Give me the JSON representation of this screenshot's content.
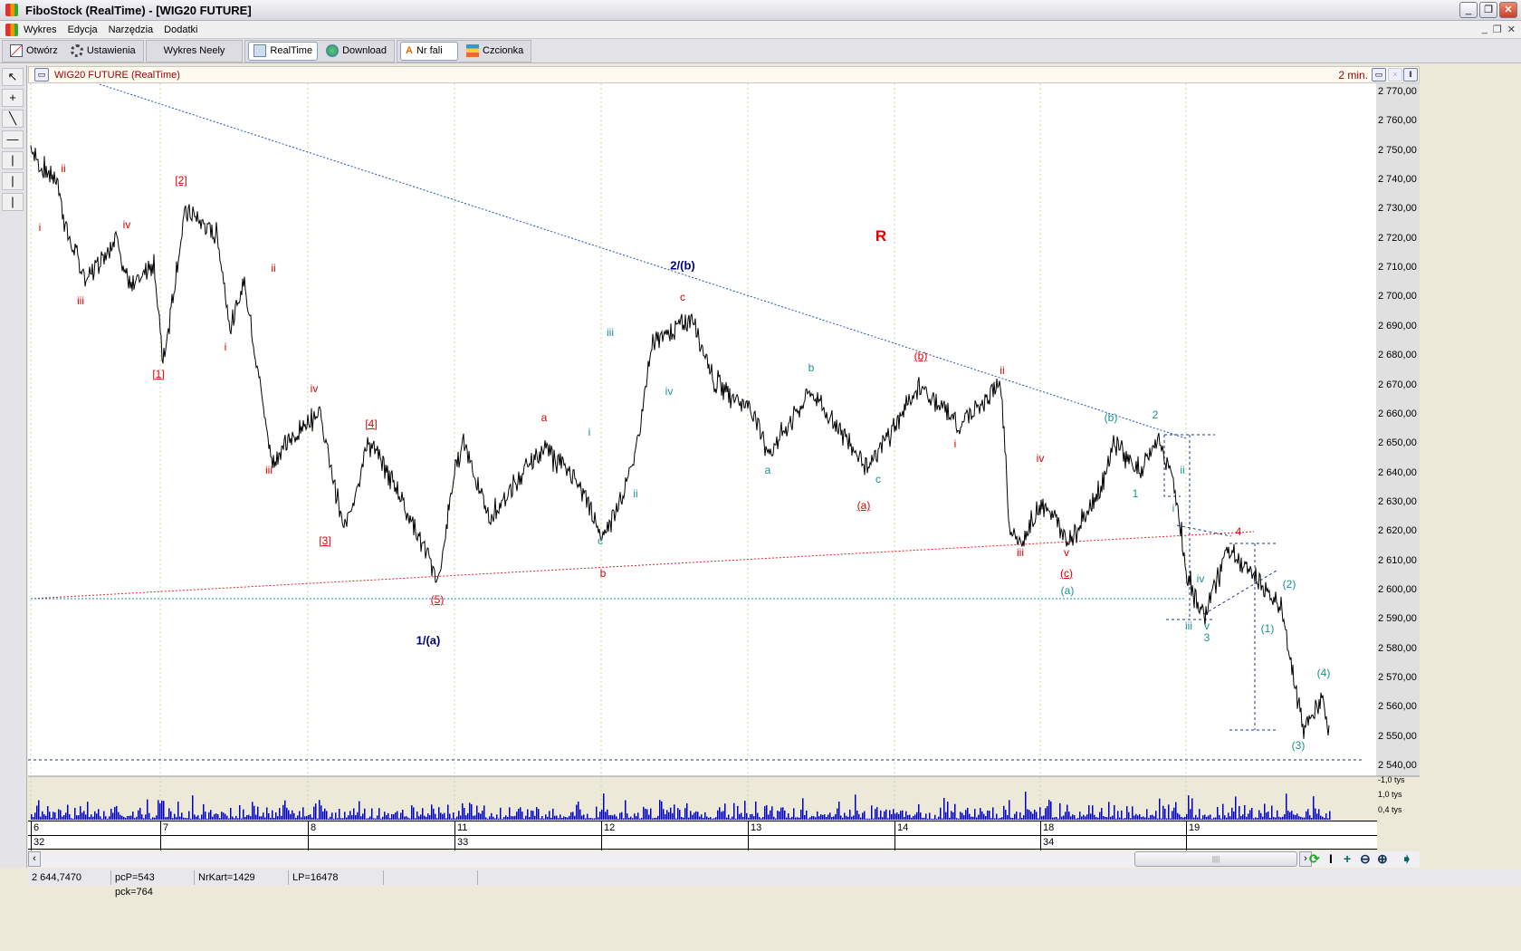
{
  "window": {
    "title": "FiboStock (RealTime) - [WIG20 FUTURE]",
    "controls": [
      "_",
      "❐",
      "✕"
    ]
  },
  "menu": {
    "items": [
      "Wykres",
      "Edycja",
      "Narzędzia",
      "Dodatki"
    ],
    "mdi_controls": [
      "_",
      "❐",
      "✕"
    ]
  },
  "toolbar": {
    "otworz": "Otwórz",
    "ustawienia": "Ustawienia",
    "wykres_neely": "Wykres Neely",
    "realtime": "RealTime",
    "download": "Download",
    "nr_fali": "Nr fali",
    "czcionka": "Czcionka"
  },
  "left_tools": [
    "pointer",
    "crosshair",
    "trend-line",
    "horizontal-line",
    "vertical-line",
    "vertical-line-2",
    "vertical-line-3"
  ],
  "chart_header": {
    "instrument": "WIG20 FUTURE (RealTime)",
    "interval": "2 min."
  },
  "colors": {
    "red": "#e00000",
    "teal": "#1a9090",
    "navy": "#000080",
    "volume": "#0000c0"
  },
  "chart_data": {
    "type": "line",
    "title": "WIG20 FUTURE (RealTime)",
    "ylim": [
      2540,
      2770
    ],
    "y_ticks": [
      "2 770,00",
      "2 760,00",
      "2 750,00",
      "2 740,00",
      "2 730,00",
      "2 720,00",
      "2 710,00",
      "2 700,00",
      "2 690,00",
      "2 680,00",
      "2 670,00",
      "2 660,00",
      "2 650,00",
      "2 640,00",
      "2 630,00",
      "2 620,00",
      "2 610,00",
      "2 600,00",
      "2 590,00",
      "2 580,00",
      "2 570,00",
      "2 560,00",
      "2 550,00",
      "2 540,00"
    ],
    "volume_ticks": [
      "1,0 tys",
      "0,4 tys"
    ],
    "days": [
      {
        "label": "6",
        "bar": 0
      },
      {
        "label": "7",
        "bar": 143
      },
      {
        "label": "8",
        "bar": 306
      },
      {
        "label": "11",
        "bar": 468
      },
      {
        "label": "12",
        "bar": 630
      },
      {
        "label": "13",
        "bar": 792
      },
      {
        "label": "14",
        "bar": 954
      },
      {
        "label": "18",
        "bar": 1115
      },
      {
        "label": "19",
        "bar": 1276
      }
    ],
    "weeks": [
      {
        "label": "32",
        "bar": 0
      },
      {
        "label": "",
        "bar": 143
      },
      {
        "label": "",
        "bar": 306
      },
      {
        "label": "33",
        "bar": 468
      },
      {
        "label": "",
        "bar": 630
      },
      {
        "label": "",
        "bar": 792
      },
      {
        "label": "",
        "bar": 954
      },
      {
        "label": "34",
        "bar": 1115
      },
      {
        "label": "",
        "bar": 1276
      }
    ],
    "price_path": [
      [
        0,
        2752
      ],
      [
        11,
        2744
      ],
      [
        28,
        2741
      ],
      [
        41,
        2721
      ],
      [
        61,
        2706
      ],
      [
        94,
        2721
      ],
      [
        111,
        2702
      ],
      [
        136,
        2712
      ],
      [
        146,
        2678
      ],
      [
        171,
        2730
      ],
      [
        206,
        2721
      ],
      [
        221,
        2689
      ],
      [
        236,
        2706
      ],
      [
        266,
        2644
      ],
      [
        318,
        2662
      ],
      [
        346,
        2620
      ],
      [
        373,
        2651
      ],
      [
        406,
        2634
      ],
      [
        451,
        2603
      ],
      [
        466,
        2637
      ],
      [
        478,
        2652
      ],
      [
        506,
        2624
      ],
      [
        566,
        2649
      ],
      [
        606,
        2637
      ],
      [
        631,
        2617
      ],
      [
        666,
        2643
      ],
      [
        686,
        2684
      ],
      [
        731,
        2693
      ],
      [
        756,
        2671
      ],
      [
        796,
        2662
      ],
      [
        816,
        2647
      ],
      [
        861,
        2668
      ],
      [
        926,
        2642
      ],
      [
        981,
        2670
      ],
      [
        1026,
        2656
      ],
      [
        1071,
        2671
      ],
      [
        1081,
        2622
      ],
      [
        1096,
        2616
      ],
      [
        1116,
        2631
      ],
      [
        1146,
        2617
      ],
      [
        1181,
        2634
      ],
      [
        1196,
        2651
      ],
      [
        1226,
        2640
      ],
      [
        1246,
        2652
      ],
      [
        1266,
        2632
      ],
      [
        1276,
        2605
      ],
      [
        1296,
        2591
      ],
      [
        1321,
        2614
      ],
      [
        1356,
        2603
      ],
      [
        1381,
        2594
      ],
      [
        1406,
        2552
      ],
      [
        1426,
        2563
      ],
      [
        1434,
        2554
      ]
    ],
    "wave_labels": [
      {
        "t": "i",
        "c": "red",
        "bar": 10,
        "p": 2724
      },
      {
        "t": "ii",
        "c": "red",
        "bar": 36,
        "p": 2744
      },
      {
        "t": "iii",
        "c": "red",
        "bar": 55,
        "p": 2699
      },
      {
        "t": "iv",
        "c": "red",
        "bar": 106,
        "p": 2725
      },
      {
        "t": "[1]",
        "c": "red",
        "bar": 141,
        "p": 2674
      },
      {
        "t": "[2]",
        "c": "red",
        "bar": 166,
        "p": 2740
      },
      {
        "t": "ii",
        "c": "red",
        "bar": 268,
        "p": 2710
      },
      {
        "t": "i",
        "c": "red",
        "bar": 215,
        "p": 2683
      },
      {
        "t": "iii",
        "c": "red",
        "bar": 263,
        "p": 2641
      },
      {
        "t": "iv",
        "c": "red",
        "bar": 313,
        "p": 2669
      },
      {
        "t": "[4]",
        "c": "red",
        "bar": 376,
        "p": 2657
      },
      {
        "t": "[3]",
        "c": "red",
        "bar": 325,
        "p": 2617
      },
      {
        "t": "(5)",
        "c": "red",
        "bar": 449,
        "p": 2597
      },
      {
        "t": "a",
        "c": "red",
        "bar": 567,
        "p": 2659
      },
      {
        "t": "i",
        "c": "teal",
        "bar": 617,
        "p": 2654
      },
      {
        "t": "iii",
        "c": "teal",
        "bar": 640,
        "p": 2688
      },
      {
        "t": "ii",
        "c": "teal",
        "bar": 668,
        "p": 2633
      },
      {
        "t": "iv",
        "c": "teal",
        "bar": 705,
        "p": 2668
      },
      {
        "t": "c",
        "c": "teal",
        "bar": 629,
        "p": 2617
      },
      {
        "t": "b",
        "c": "red",
        "bar": 632,
        "p": 2606
      },
      {
        "t": "c",
        "c": "red",
        "bar": 720,
        "p": 2700
      },
      {
        "t": "2/(b)",
        "c": "navy",
        "bar": 720,
        "p": 2711
      },
      {
        "t": "1/(a)",
        "c": "navy",
        "bar": 439,
        "p": 2583
      },
      {
        "t": "R",
        "c": "red big",
        "bar": 939,
        "p": 2721
      },
      {
        "t": "b",
        "c": "teal",
        "bar": 862,
        "p": 2676
      },
      {
        "t": "a",
        "c": "teal",
        "bar": 814,
        "p": 2641
      },
      {
        "t": "c",
        "c": "teal",
        "bar": 936,
        "p": 2638
      },
      {
        "t": "(a)",
        "c": "red",
        "bar": 920,
        "p": 2629
      },
      {
        "t": "(b)",
        "c": "red",
        "bar": 983,
        "p": 2680
      },
      {
        "t": "i",
        "c": "red",
        "bar": 1021,
        "p": 2650
      },
      {
        "t": "ii",
        "c": "red",
        "bar": 1073,
        "p": 2675
      },
      {
        "t": "iv",
        "c": "red",
        "bar": 1115,
        "p": 2645
      },
      {
        "t": "iii",
        "c": "red",
        "bar": 1093,
        "p": 2613
      },
      {
        "t": "v",
        "c": "red",
        "bar": 1144,
        "p": 2613
      },
      {
        "t": "(c)",
        "c": "red",
        "bar": 1144,
        "p": 2606
      },
      {
        "t": "(a)",
        "c": "teal",
        "bar": 1145,
        "p": 2600
      },
      {
        "t": "(b)",
        "c": "teal",
        "bar": 1193,
        "p": 2659
      },
      {
        "t": "2",
        "c": "teal",
        "bar": 1242,
        "p": 2660
      },
      {
        "t": "1",
        "c": "teal",
        "bar": 1220,
        "p": 2633
      },
      {
        "t": "ii",
        "c": "teal",
        "bar": 1272,
        "p": 2641
      },
      {
        "t": "i",
        "c": "teal",
        "bar": 1262,
        "p": 2628
      },
      {
        "t": "iv",
        "c": "teal",
        "bar": 1292,
        "p": 2604
      },
      {
        "t": "iii",
        "c": "teal",
        "bar": 1279,
        "p": 2588
      },
      {
        "t": "v",
        "c": "teal",
        "bar": 1299,
        "p": 2588
      },
      {
        "t": "3",
        "c": "teal",
        "bar": 1299,
        "p": 2584
      },
      {
        "t": "4",
        "c": "red",
        "bar": 1334,
        "p": 2620
      },
      {
        "t": "(2)",
        "c": "teal",
        "bar": 1390,
        "p": 2602
      },
      {
        "t": "(1)",
        "c": "teal",
        "bar": 1366,
        "p": 2587
      },
      {
        "t": "(4)",
        "c": "teal",
        "bar": 1428,
        "p": 2572
      },
      {
        "t": "(3)",
        "c": "teal",
        "bar": 1400,
        "p": 2547
      }
    ]
  },
  "status": {
    "price": "2 644,7470",
    "pc": "pcP=543  pck=764",
    "nrkart": "NrKart=1429",
    "lp": "LP=16478"
  }
}
